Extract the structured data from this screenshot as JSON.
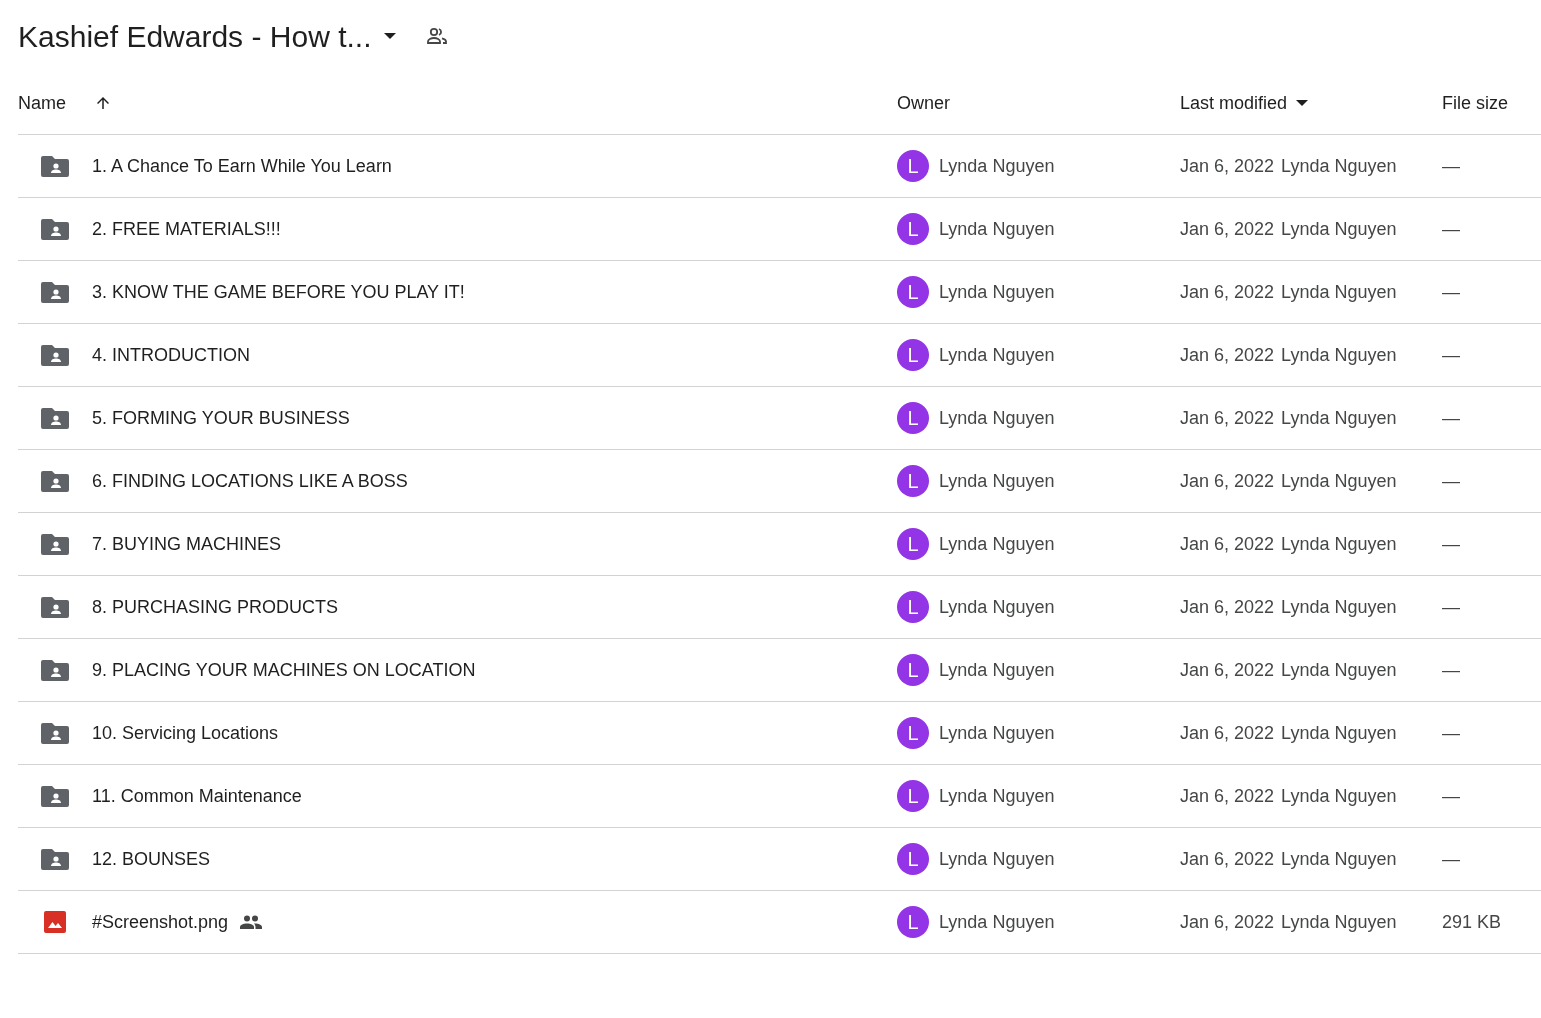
{
  "header": {
    "title": "Kashief Edwards - How t..."
  },
  "table": {
    "columns": [
      {
        "label": "Name",
        "kind": "ascending"
      },
      {
        "label": "Owner",
        "kind": "plain"
      },
      {
        "label": "Last modified",
        "kind": "descending"
      },
      {
        "label": "File size",
        "kind": "plain"
      }
    ],
    "rows": [
      {
        "kind": "folder",
        "name": "1. A Chance To Earn While You Learn",
        "shared": false,
        "avatar": "L",
        "color": "#9334e6",
        "owner": "Lynda Nguyen",
        "date": "Jan 6, 2022",
        "modified_by": "Lynda Nguyen",
        "size": "—"
      },
      {
        "kind": "folder",
        "name": "2. FREE MATERIALS!!!",
        "shared": false,
        "avatar": "L",
        "color": "#9334e6",
        "owner": "Lynda Nguyen",
        "date": "Jan 6, 2022",
        "modified_by": "Lynda Nguyen",
        "size": "—"
      },
      {
        "kind": "folder",
        "name": "3. KNOW THE GAME BEFORE YOU PLAY IT!",
        "shared": false,
        "avatar": "L",
        "color": "#9334e6",
        "owner": "Lynda Nguyen",
        "date": "Jan 6, 2022",
        "modified_by": "Lynda Nguyen",
        "size": "—"
      },
      {
        "kind": "folder",
        "name": "4. INTRODUCTION",
        "shared": false,
        "avatar": "L",
        "color": "#9334e6",
        "owner": "Lynda Nguyen",
        "date": "Jan 6, 2022",
        "modified_by": "Lynda Nguyen",
        "size": "—"
      },
      {
        "kind": "folder",
        "name": "5. FORMING YOUR BUSINESS",
        "shared": false,
        "avatar": "L",
        "color": "#9334e6",
        "owner": "Lynda Nguyen",
        "date": "Jan 6, 2022",
        "modified_by": "Lynda Nguyen",
        "size": "—"
      },
      {
        "kind": "folder",
        "name": "6. FINDING LOCATIONS LIKE A BOSS",
        "shared": false,
        "avatar": "L",
        "color": "#9334e6",
        "owner": "Lynda Nguyen",
        "date": "Jan 6, 2022",
        "modified_by": "Lynda Nguyen",
        "size": "—"
      },
      {
        "kind": "folder",
        "name": "7. BUYING MACHINES",
        "shared": false,
        "avatar": "L",
        "color": "#9334e6",
        "owner": "Lynda Nguyen",
        "date": "Jan 6, 2022",
        "modified_by": "Lynda Nguyen",
        "size": "—"
      },
      {
        "kind": "folder",
        "name": "8. PURCHASING PRODUCTS",
        "shared": false,
        "avatar": "L",
        "color": "#9334e6",
        "owner": "Lynda Nguyen",
        "date": "Jan 6, 2022",
        "modified_by": "Lynda Nguyen",
        "size": "—"
      },
      {
        "kind": "folder",
        "name": "9. PLACING YOUR MACHINES ON LOCATION",
        "shared": false,
        "avatar": "L",
        "color": "#9334e6",
        "owner": "Lynda Nguyen",
        "date": "Jan 6, 2022",
        "modified_by": "Lynda Nguyen",
        "size": "—"
      },
      {
        "kind": "folder",
        "name": "10. Servicing Locations",
        "shared": false,
        "avatar": "L",
        "color": "#9334e6",
        "owner": "Lynda Nguyen",
        "date": "Jan 6, 2022",
        "modified_by": "Lynda Nguyen",
        "size": "—"
      },
      {
        "kind": "folder",
        "name": "11. Common Maintenance",
        "shared": false,
        "avatar": "L",
        "color": "#9334e6",
        "owner": "Lynda Nguyen",
        "date": "Jan 6, 2022",
        "modified_by": "Lynda Nguyen",
        "size": "—"
      },
      {
        "kind": "folder",
        "name": "12. BOUNSES",
        "shared": false,
        "avatar": "L",
        "color": "#9334e6",
        "owner": "Lynda Nguyen",
        "date": "Jan 6, 2022",
        "modified_by": "Lynda Nguyen",
        "size": "—"
      },
      {
        "kind": "image",
        "name": "#Screenshot.png",
        "shared": true,
        "avatar": "L",
        "color": "#9334e6",
        "owner": "Lynda Nguyen",
        "date": "Jan 6, 2022",
        "modified_by": "Lynda Nguyen",
        "size": "291 KB"
      }
    ]
  }
}
